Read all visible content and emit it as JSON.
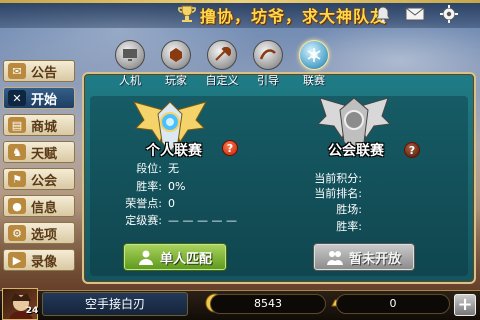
{
  "top_bar": {
    "marquee": "撸协，坊爷，求大神队友"
  },
  "left_menu": {
    "items": [
      {
        "label": "公告",
        "icon": "announcement-icon",
        "glyph": "✉"
      },
      {
        "label": "开始",
        "icon": "crossed-swords-icon",
        "glyph": "✕",
        "active": true
      },
      {
        "label": "商城",
        "icon": "shop-icon",
        "glyph": "▤"
      },
      {
        "label": "天赋",
        "icon": "talent-icon",
        "glyph": "♞"
      },
      {
        "label": "公会",
        "icon": "guild-icon",
        "glyph": "⚑"
      },
      {
        "label": "信息",
        "icon": "profile-icon",
        "glyph": "●"
      },
      {
        "label": "选项",
        "icon": "options-icon",
        "glyph": "⚙"
      },
      {
        "label": "录像",
        "icon": "replay-icon",
        "glyph": "▶"
      }
    ]
  },
  "tabs": [
    {
      "label": "人机",
      "icon": "computer-icon"
    },
    {
      "label": "玩家",
      "icon": "player-helmet-icon"
    },
    {
      "label": "自定义",
      "icon": "custom-axe-icon"
    },
    {
      "label": "引导",
      "icon": "guide-icon"
    },
    {
      "label": "联赛",
      "icon": "league-icon",
      "active": true
    }
  ],
  "personal_league": {
    "title": "个人联赛",
    "stats": [
      {
        "label": "段位:",
        "value": "无"
      },
      {
        "label": "胜率:",
        "value": "0%"
      },
      {
        "label": "荣誉点:",
        "value": "0"
      },
      {
        "label": "定级赛:",
        "value": "— — — — —"
      }
    ],
    "button": "单人匹配"
  },
  "guild_league": {
    "title": "公会联赛",
    "stats": [
      {
        "label": "当前积分:",
        "value": ""
      },
      {
        "label": "当前排名:",
        "value": ""
      },
      {
        "label": "胜场:",
        "value": ""
      },
      {
        "label": "胜率:",
        "value": ""
      }
    ],
    "button": "暂未开放"
  },
  "bottom_bar": {
    "level": "24",
    "player_name": "空手接白刃",
    "coins": "8543",
    "ingots": "0",
    "add_label": "+"
  },
  "colors": {
    "panel": "#1f7c86",
    "accent_gold": "#d9c28a",
    "match_button": "#7fb83a",
    "disabled_button": "#9e9e9e",
    "help_red": "#d9361a"
  }
}
